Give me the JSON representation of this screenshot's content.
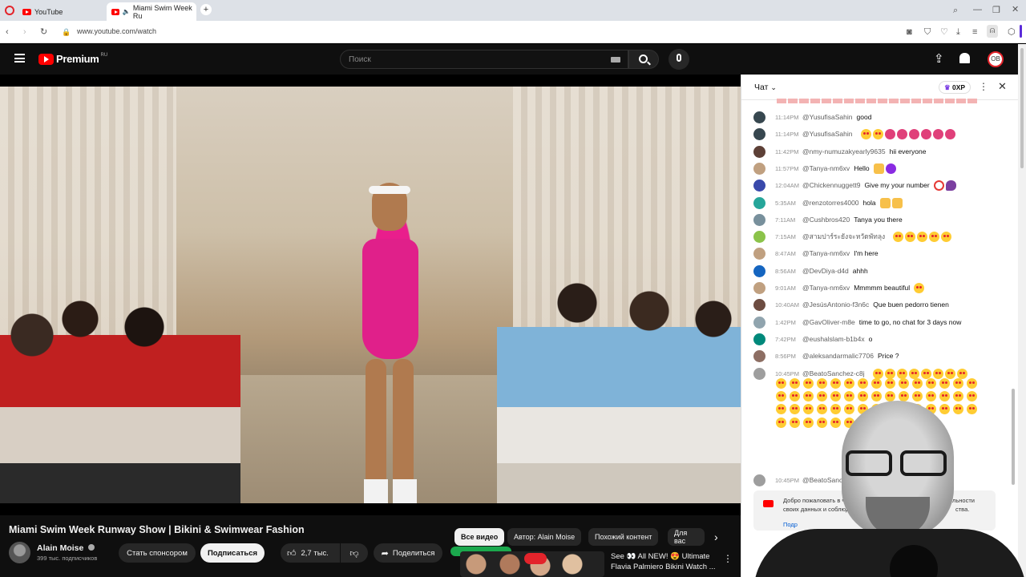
{
  "browser": {
    "tabs": [
      {
        "label": "YouTube"
      },
      {
        "label": "Miami Swim Week Ru"
      }
    ],
    "new_tab": "+",
    "url": "www.youtube.com/watch"
  },
  "youtube": {
    "logo": "Premium",
    "region": "RU",
    "search_placeholder": "Поиск",
    "avatar_initials": "ОВ"
  },
  "video": {
    "title": "Miami Swim Week Runway Show | Bikini & Swimwear Fashion",
    "channel": "Alain Moise",
    "subscribers": "399 тыс. подписчиков",
    "sponsor_label": "Стать спонсором",
    "subscribe_label": "Подписаться",
    "likes": "2,7 тыс.",
    "share_label": "Поделиться",
    "more_label": "..."
  },
  "chips": [
    "Все видео",
    "Автор: Alain Moise",
    "Похожий контент",
    "Для вас"
  ],
  "recommendation": {
    "line1": "See 👀 All NEW! 😍 Ultimate",
    "line2": "Flavia Palmiero Bikini Watch ..."
  },
  "chat": {
    "title": "Чат",
    "xp": "0XP",
    "messages": [
      {
        "time": "11:14PM",
        "author": "@YusufisaSahin",
        "text": "good",
        "emoji": [],
        "avatar": "#37474f"
      },
      {
        "time": "11:14PM",
        "author": "@YusufisaSahin",
        "text": "",
        "emoji": [
          "heart",
          "heart",
          "tongue",
          "tongue",
          "tongue",
          "tongue",
          "tongue",
          "tongue"
        ],
        "avatar": "#37474f"
      },
      {
        "time": "11:42PM",
        "author": "@nmy-numuzakyearly9635",
        "text": "hii everyone",
        "emoji": [],
        "avatar": "#5d4037"
      },
      {
        "time": "11:57PM",
        "author": "@Tanya-nm6xv",
        "text": "Hello",
        "emoji": [
          "wave",
          "purple"
        ],
        "avatar": "#c0a080"
      },
      {
        "time": "12:04AM",
        "author": "@Chickennuggett9",
        "text": "Give my your number",
        "emoji": [
          "ring",
          "eggplant"
        ],
        "avatar": "#3949ab"
      },
      {
        "time": "5:35AM",
        "author": "@renzotorres4000",
        "text": "hola",
        "emoji": [
          "wave",
          "wave"
        ],
        "avatar": "#26a69a"
      },
      {
        "time": "7:11AM",
        "author": "@Cushbros420",
        "text": "Tanya you there",
        "emoji": [],
        "avatar": "#78909c"
      },
      {
        "time": "7:15AM",
        "author": "@สามปาร์ระยังจะหวัดพัทลุง",
        "text": "",
        "emoji": [
          "heart",
          "heart",
          "heart",
          "heart",
          "heart"
        ],
        "avatar": "#8bc34a"
      },
      {
        "time": "8:47AM",
        "author": "@Tanya-nm6xv",
        "text": "I'm here",
        "emoji": [],
        "avatar": "#c0a080"
      },
      {
        "time": "8:56AM",
        "author": "@DevDiya-d4d",
        "text": "ahhh",
        "emoji": [],
        "avatar": "#1565c0"
      },
      {
        "time": "9:01AM",
        "author": "@Tanya-nm6xv",
        "text": "Mmmmm beautiful",
        "emoji": [
          "heart"
        ],
        "avatar": "#c0a080"
      },
      {
        "time": "10:40AM",
        "author": "@JesúsAntonio-f3n6c",
        "text": "Que buen pedorro tienen",
        "emoji": [],
        "avatar": "#6d4c41"
      },
      {
        "time": "1:42PM",
        "author": "@GavOliver-m8e",
        "text": "time to go, no chat for 3 days now",
        "emoji": [],
        "avatar": "#90a4ae"
      },
      {
        "time": "7:42PM",
        "author": "@eushalslam-b1b4x",
        "text": "o",
        "emoji": [],
        "avatar": "#00897b"
      },
      {
        "time": "8:56PM",
        "author": "@aleksandarmalic7706",
        "text": "Price ?",
        "emoji": [],
        "avatar": "#8d6e63"
      },
      {
        "time": "10:45PM",
        "author": "@BeatoSanchez-c8j",
        "text": "",
        "emoji": [
          "heart",
          "heart",
          "heart",
          "heart",
          "heart",
          "heart",
          "heart",
          "heart"
        ],
        "avatar": "#9e9e9e"
      }
    ],
    "last_time": "10:45PM",
    "last_author": "@BeatoSanc",
    "welcome_line1": "Добро пожаловать в ча",
    "welcome_line1_end": "льности",
    "welcome_line2": "своих данных и соблюда",
    "welcome_line2_end": "ства.",
    "welcome_link": "Подр"
  }
}
